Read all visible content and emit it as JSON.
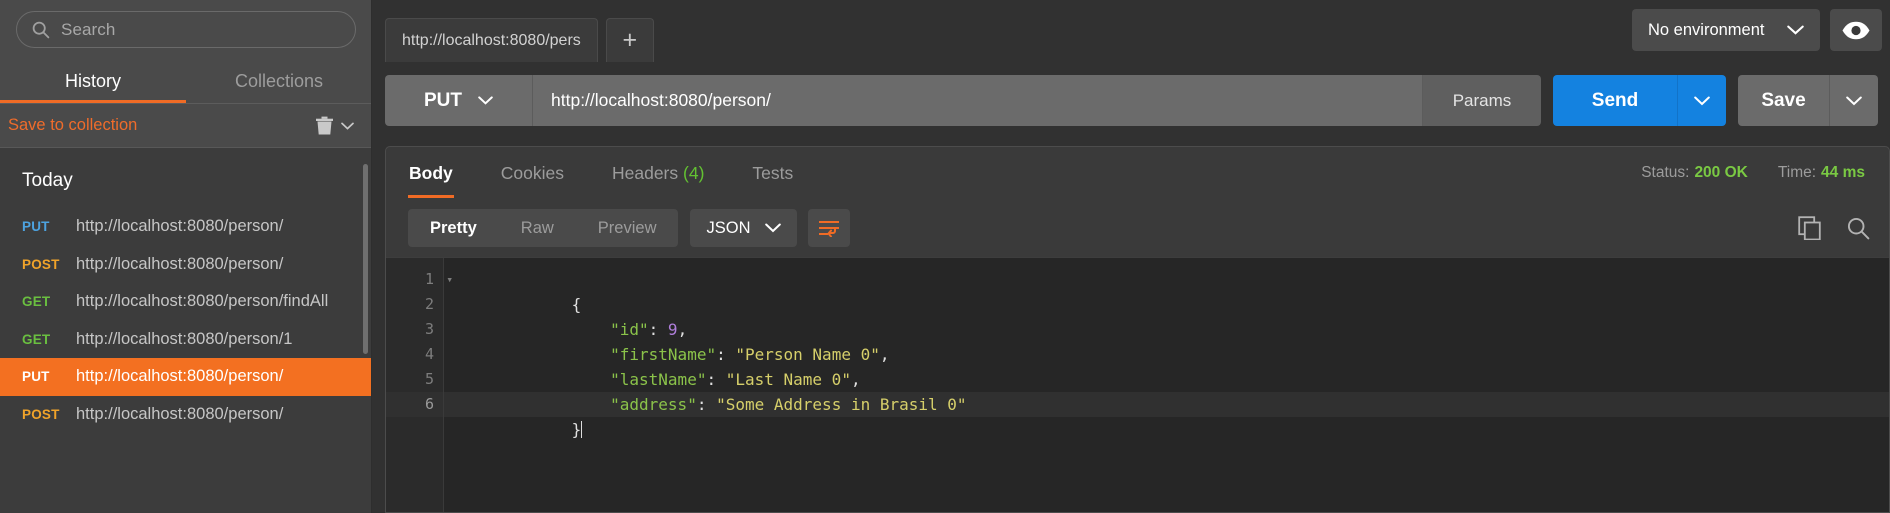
{
  "sidebar": {
    "search": {
      "placeholder": "Search",
      "icon": "search-icon"
    },
    "tabs": [
      {
        "label": "History",
        "active": true
      },
      {
        "label": "Collections",
        "active": false
      }
    ],
    "save_to_collection": "Save to collection",
    "trash_icon": "trash-icon",
    "group_title": "Today",
    "history": [
      {
        "method": "PUT",
        "url": "http://localhost:8080/person/",
        "selected": false
      },
      {
        "method": "POST",
        "url": "http://localhost:8080/person/",
        "selected": false
      },
      {
        "method": "GET",
        "url": "http://localhost:8080/person/findAll",
        "selected": false
      },
      {
        "method": "GET",
        "url": "http://localhost:8080/person/1",
        "selected": false
      },
      {
        "method": "PUT",
        "url": "http://localhost:8080/person/",
        "selected": true
      },
      {
        "method": "POST",
        "url": "http://localhost:8080/person/",
        "selected": false
      }
    ]
  },
  "tabstrip": {
    "request_tab": "http://localhost:8080/pers",
    "add_tab": "+",
    "environment": "No environment",
    "eye_icon": "eye-icon",
    "chevron_icon": "chevron-down-icon"
  },
  "request": {
    "method": "PUT",
    "url": "http://localhost:8080/person/",
    "params_label": "Params",
    "send_label": "Send",
    "save_label": "Save"
  },
  "response": {
    "tabs": [
      {
        "label": "Body",
        "count": "",
        "active": true
      },
      {
        "label": "Cookies",
        "count": "",
        "active": false
      },
      {
        "label": "Headers",
        "count": "(4)",
        "active": false
      },
      {
        "label": "Tests",
        "count": "",
        "active": false
      }
    ],
    "status_label": "Status:",
    "status_value": "200 OK",
    "time_label": "Time:",
    "time_value": "44 ms",
    "formats": [
      {
        "label": "Pretty",
        "active": true
      },
      {
        "label": "Raw",
        "active": false
      },
      {
        "label": "Preview",
        "active": false
      }
    ],
    "content_type": "JSON",
    "wrap_icon": "word-wrap-icon",
    "copy_icon": "copy-icon",
    "search_icon": "search-icon"
  },
  "code": {
    "lines": [
      {
        "n": "1",
        "folder": true,
        "cur": false,
        "tokens": [
          {
            "t": "punc",
            "v": "{"
          }
        ]
      },
      {
        "n": "2",
        "folder": false,
        "cur": false,
        "tokens": [
          {
            "t": "key",
            "v": "    \"id\""
          },
          {
            "t": "punc",
            "v": ": "
          },
          {
            "t": "num",
            "v": "9"
          },
          {
            "t": "punc",
            "v": ","
          }
        ]
      },
      {
        "n": "3",
        "folder": false,
        "cur": false,
        "tokens": [
          {
            "t": "key",
            "v": "    \"firstName\""
          },
          {
            "t": "punc",
            "v": ": "
          },
          {
            "t": "str",
            "v": "\"Person Name 0\""
          },
          {
            "t": "punc",
            "v": ","
          }
        ]
      },
      {
        "n": "4",
        "folder": false,
        "cur": false,
        "tokens": [
          {
            "t": "key",
            "v": "    \"lastName\""
          },
          {
            "t": "punc",
            "v": ": "
          },
          {
            "t": "str",
            "v": "\"Last Name 0\""
          },
          {
            "t": "punc",
            "v": ","
          }
        ]
      },
      {
        "n": "5",
        "folder": false,
        "cur": false,
        "tokens": [
          {
            "t": "key",
            "v": "    \"address\""
          },
          {
            "t": "punc",
            "v": ": "
          },
          {
            "t": "str",
            "v": "\"Some Address in Brasil 0\""
          }
        ]
      },
      {
        "n": "6",
        "folder": false,
        "cur": true,
        "tokens": [
          {
            "t": "punc",
            "v": "}"
          }
        ]
      }
    ]
  },
  "colors": {
    "accent_orange": "#f37021",
    "send_blue": "#1482e0",
    "status_green": "#7ac943",
    "method_get": "#6abf40",
    "method_post": "#f0a32a",
    "method_put": "#4da3e0"
  }
}
